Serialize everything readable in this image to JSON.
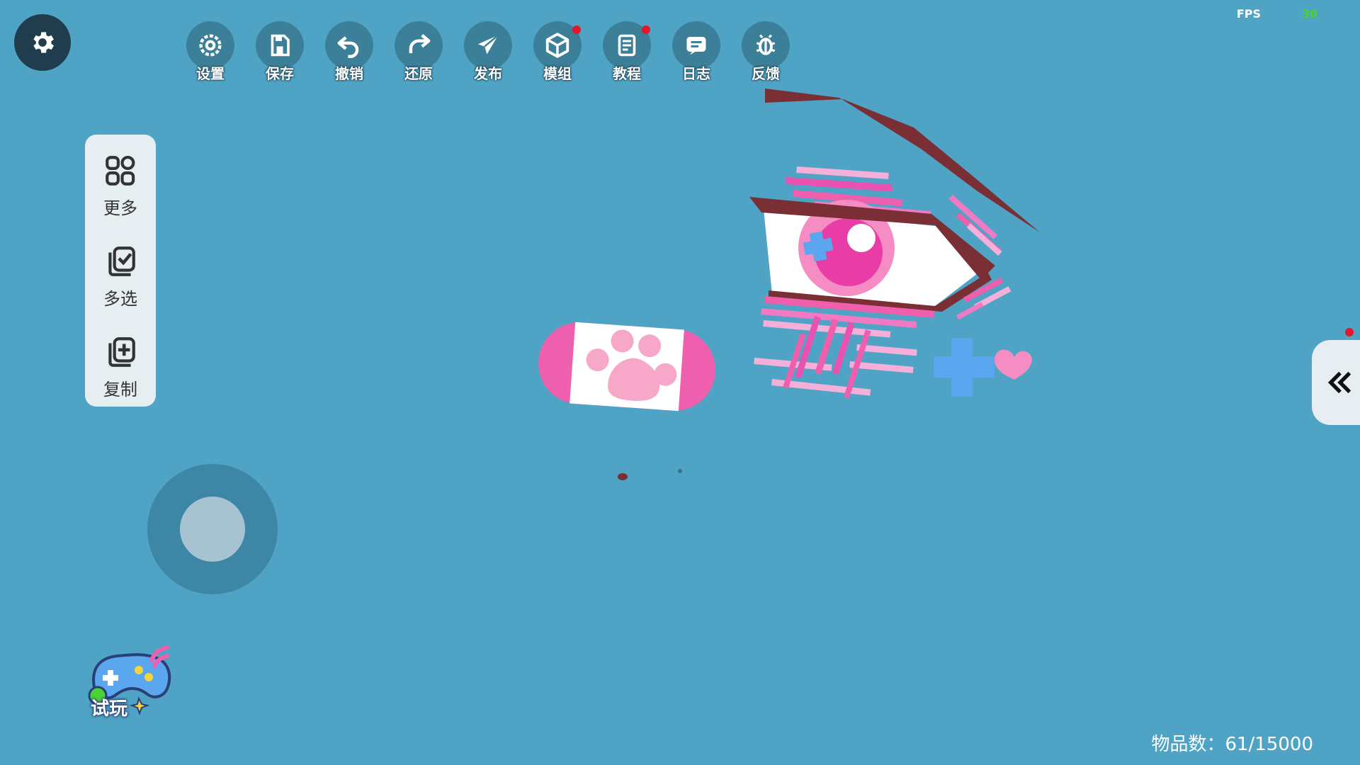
{
  "toolbar": {
    "items": [
      {
        "label": "设置",
        "icon": "settings-icon",
        "badge": false
      },
      {
        "label": "保存",
        "icon": "save-icon",
        "badge": false
      },
      {
        "label": "撤销",
        "icon": "undo-icon",
        "badge": false
      },
      {
        "label": "还原",
        "icon": "redo-icon",
        "badge": false
      },
      {
        "label": "发布",
        "icon": "publish-icon",
        "badge": false
      },
      {
        "label": "模组",
        "icon": "module-icon",
        "badge": true
      },
      {
        "label": "教程",
        "icon": "tutorial-icon",
        "badge": true
      },
      {
        "label": "日志",
        "icon": "log-icon",
        "badge": false
      },
      {
        "label": "反馈",
        "icon": "bug-icon",
        "badge": false
      }
    ]
  },
  "fps": {
    "label": "FPS",
    "value": "30"
  },
  "side_panel": {
    "items": [
      {
        "label": "更多",
        "icon": "grid-icon"
      },
      {
        "label": "多选",
        "icon": "multi-select-icon"
      },
      {
        "label": "复制",
        "icon": "copy-icon"
      }
    ]
  },
  "playtest": {
    "label": "试玩",
    "icon": "gamepad-icon"
  },
  "status": {
    "item_count": "物品数：61/15000"
  },
  "colors": {
    "background": "#4fa3c5",
    "toolbar_button": "#3b7f99",
    "badge": "#e3172b",
    "fps_value": "#4cd137",
    "accent_pink": "#ee5fae",
    "accent_blue": "#5aa7ef",
    "eyebrow": "#7a2f34"
  }
}
